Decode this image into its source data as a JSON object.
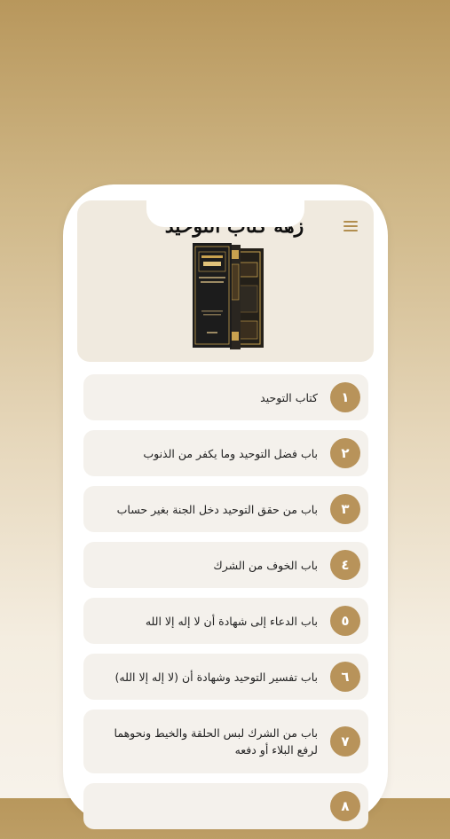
{
  "header": {
    "title": "زهة كتاب التوحيد",
    "menu_icon": "hamburger-menu-icon",
    "book_cover": {
      "top_text": "كتاب التوحيد",
      "colors": {
        "cover": "#1c1c1c",
        "gold": "#c9a24f",
        "spine": "#2a2620"
      }
    }
  },
  "chapters": [
    {
      "number": "١",
      "title": "كتاب التوحيد"
    },
    {
      "number": "٢",
      "title": "باب فضل التوحيد وما يكفر من الذنوب"
    },
    {
      "number": "٣",
      "title": "باب من حقق التوحيد دخل الجنة بغير حساب"
    },
    {
      "number": "٤",
      "title": "باب الخوف من الشرك"
    },
    {
      "number": "٥",
      "title": "باب الدعاء إلى شهادة أن لا إله إلا الله"
    },
    {
      "number": "٦",
      "title": "باب تفسير التوحيد وشهادة أن (لا إله إلا الله)"
    },
    {
      "number": "٧",
      "title": "باب من الشرك لبس الحلقة والخيط ونحوهما لرفع البلاء أو دفعه"
    },
    {
      "number": "٨",
      "title": ""
    }
  ],
  "colors": {
    "accent": "#b8935a",
    "card": "#f4f1ec",
    "header_bg": "#f0eadf"
  }
}
